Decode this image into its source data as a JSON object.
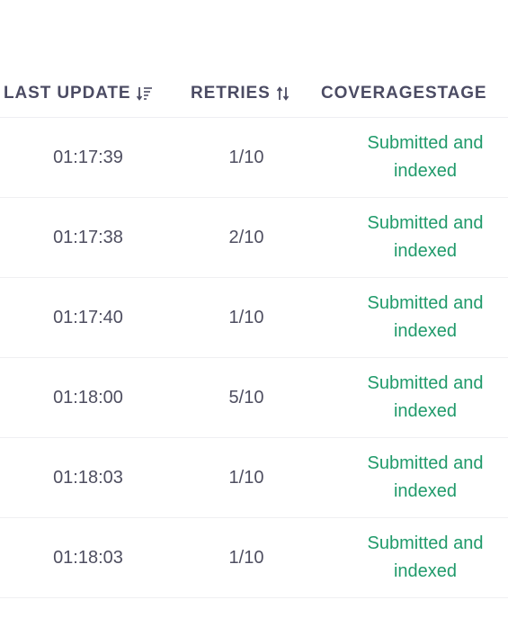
{
  "table": {
    "headers": [
      {
        "label": "LAST UPDATE",
        "sort_icon": "sort-descending-icon"
      },
      {
        "label": "RETRIES",
        "sort_icon": "sort-both-icon"
      },
      {
        "label": "COVERAGESTAGE"
      }
    ],
    "rows": [
      {
        "last_update": "01:17:39",
        "retries": "1/10",
        "coverage_stage": "Submitted and indexed"
      },
      {
        "last_update": "01:17:38",
        "retries": "2/10",
        "coverage_stage": "Submitted and indexed"
      },
      {
        "last_update": "01:17:40",
        "retries": "1/10",
        "coverage_stage": "Submitted and indexed"
      },
      {
        "last_update": "01:18:00",
        "retries": "5/10",
        "coverage_stage": "Submitted and indexed"
      },
      {
        "last_update": "01:18:03",
        "retries": "1/10",
        "coverage_stage": "Submitted and indexed"
      },
      {
        "last_update": "01:18:03",
        "retries": "1/10",
        "coverage_stage": "Submitted and indexed"
      }
    ],
    "colors": {
      "header_text": "#4b4b63",
      "cell_text": "#4e4e60",
      "status_green": "#1f9a6a"
    }
  }
}
